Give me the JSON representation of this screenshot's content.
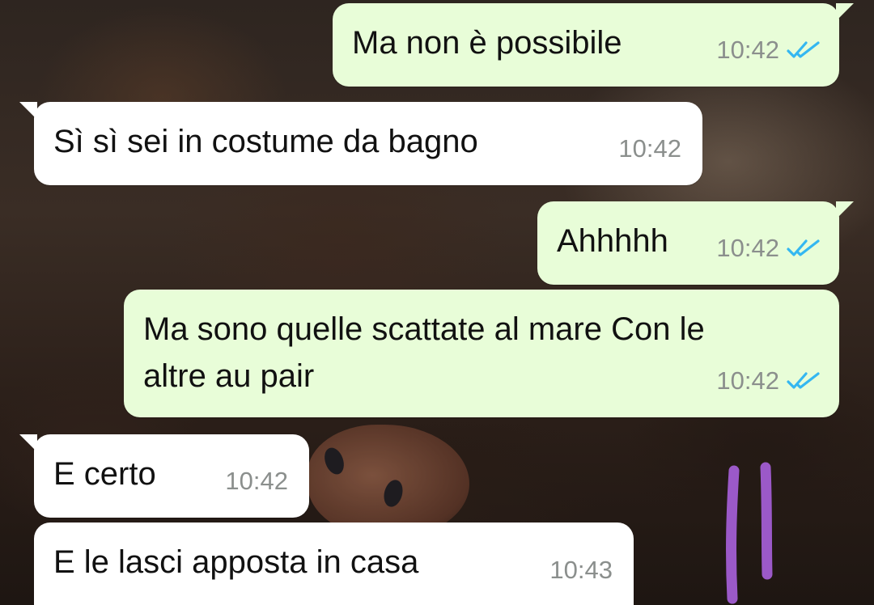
{
  "chat": {
    "messages": [
      {
        "direction": "outgoing",
        "text": "Ma non è possibile",
        "time": "10:42",
        "status": "read"
      },
      {
        "direction": "incoming",
        "text": "Sì sì sei in costume da bagno",
        "time": "10:42"
      },
      {
        "direction": "outgoing",
        "text": "Ahhhhh",
        "time": "10:42",
        "status": "read"
      },
      {
        "direction": "outgoing",
        "text": "Ma sono quelle scattate al mare Con le\naltre au pair",
        "time": "10:42",
        "status": "read"
      },
      {
        "direction": "incoming",
        "text": "E certo",
        "time": "10:42"
      },
      {
        "direction": "incoming",
        "text": "E le lasci apposta in casa",
        "time": "10:43"
      }
    ]
  },
  "colors": {
    "outgoing_bubble": "#e8fdd8",
    "incoming_bubble": "#ffffff",
    "timestamp": "#8b8f8d",
    "read_ticks": "#34b7f1",
    "drawn_marks": "#9b59c8"
  },
  "icons": {
    "read_receipt": "double-check-icon",
    "annotation": "hand-drawn-marks"
  }
}
